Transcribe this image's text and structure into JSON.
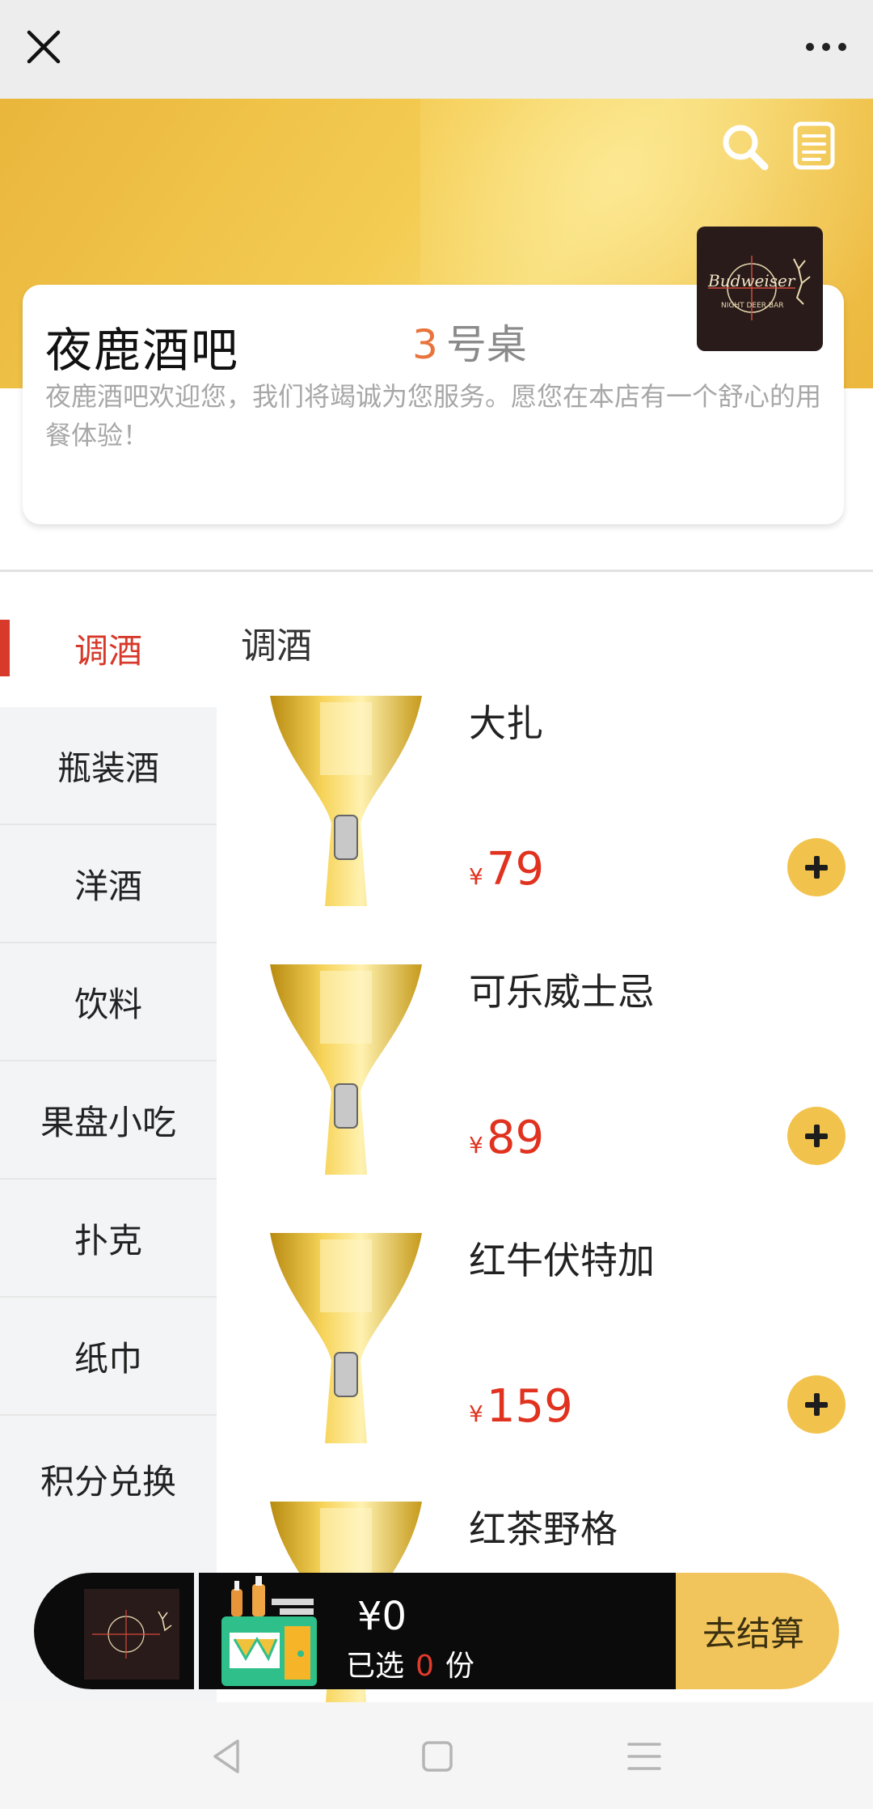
{
  "store": {
    "name": "夜鹿酒吧",
    "table_number": "3",
    "table_suffix": "号桌",
    "description": "夜鹿酒吧欢迎您，我们将竭诚为您服务。愿您在本店有一个舒心的用餐体验！",
    "logo_text_top": "Budweiser",
    "logo_text_bottom": "NIGHT DEER BAR"
  },
  "sidebar": {
    "items": [
      {
        "label": "调酒"
      },
      {
        "label": "瓶装酒"
      },
      {
        "label": "洋酒"
      },
      {
        "label": "饮料"
      },
      {
        "label": "果盘小吃"
      },
      {
        "label": "扑克"
      },
      {
        "label": "纸巾"
      },
      {
        "label": "积分兑换"
      }
    ]
  },
  "section": {
    "title": "调酒"
  },
  "products": [
    {
      "name": "大扎",
      "currency": "¥",
      "price": "79"
    },
    {
      "name": "可乐威士忌",
      "currency": "¥",
      "price": "89"
    },
    {
      "name": "红牛伏特加",
      "currency": "¥",
      "price": "159"
    },
    {
      "name": "红茶野格",
      "currency": "¥",
      "price": ""
    }
  ],
  "cart": {
    "total": "¥0",
    "selected_prefix": "已选",
    "selected_count": "0",
    "selected_suffix": "份",
    "checkout_label": "去结算"
  },
  "icons": {
    "close": "close-icon",
    "more": "more-icon",
    "search": "search-icon",
    "order_list": "order-list-icon",
    "add": "plus-icon",
    "cart": "cart-icon",
    "back": "back-icon",
    "home": "home-icon",
    "menu": "menu-icon"
  },
  "colors": {
    "accent_red": "#d7392a",
    "price_red": "#e0321f",
    "banner_yellow": "#f4cc52",
    "button_yellow": "#f2c34c",
    "table_orange": "#e8743b"
  }
}
